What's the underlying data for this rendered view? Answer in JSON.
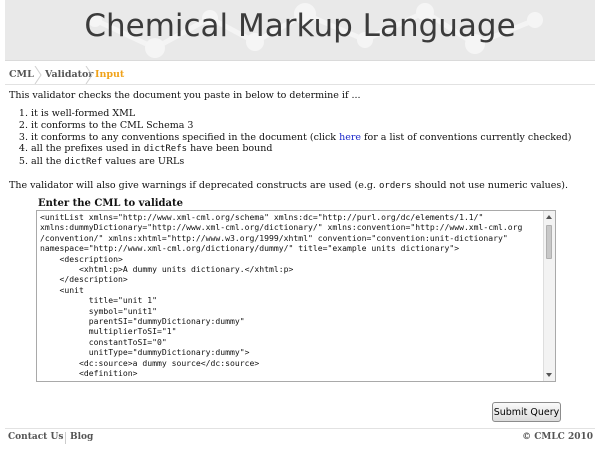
{
  "header": {
    "title": "Chemical Markup Language"
  },
  "breadcrumb": [
    {
      "label": "CML",
      "active": false
    },
    {
      "label": "Validator",
      "active": false
    },
    {
      "label": "Input",
      "active": true
    }
  ],
  "intro": "This validator checks the document you paste in below to determine if ...",
  "checks": {
    "c1": "it is well-formed XML",
    "c2": "it conforms to the CML Schema 3",
    "c3_before": "it conforms to any conventions specified in the document (click ",
    "c3_link": "here",
    "c3_after": " for a list of conventions currently checked)",
    "c4_before": "all the prefixes used in ",
    "c4_code": "dictRefs",
    "c4_after": " have been bound",
    "c5_before": "all the ",
    "c5_code": "dictRef",
    "c5_after": " values are URLs"
  },
  "warning": {
    "before": "The validator will also give warnings if deprecated constructs are used (e.g. ",
    "code": "orders",
    "after": " should not use numeric values)."
  },
  "form": {
    "label": "Enter the CML to validate",
    "content": "<unitList xmlns=\"http://www.xml-cml.org/schema\" xmlns:dc=\"http://purl.org/dc/elements/1.1/\"\nxmlns:dummyDictionary=\"http://www.xml-cml.org/dictionary/\" xmlns:convention=\"http://www.xml-cml.org\n/convention/\" xmlns:xhtml=\"http://www.w3.org/1999/xhtml\" convention=\"convention:unit-dictionary\"\nnamespace=\"http://www.xml-cml.org/dictionary/dummy/\" title=\"example units dictionary\">\n    <description>\n        <xhtml:p>A dummy units dictionary.</xhtml:p>\n    </description>\n    <unit\n          title=\"unit 1\"\n          symbol=\"unit1\"\n          parentSI=\"dummyDictionary:dummy\"\n          multiplierToSI=\"1\"\n          constantToSI=\"0\"\n          unitType=\"dummyDictionary:dummy\">\n        <dc:source>a dummy source</dc:source>\n        <definition>\n          <xhtml:p>",
    "submit_label": "Submit Query"
  },
  "footer": {
    "contact": "Contact Us",
    "blog": "Blog",
    "copyright": "© CMLC 2010"
  }
}
